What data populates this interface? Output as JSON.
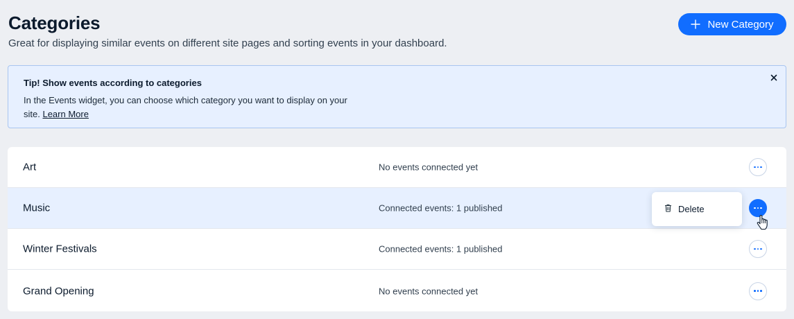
{
  "header": {
    "title": "Categories",
    "subtitle": "Great for displaying similar events on different site pages and sorting events in your dashboard.",
    "new_button_label": "New Category",
    "new_button_icon": "plus-icon"
  },
  "tip": {
    "title": "Tip! Show events according to categories",
    "body": "In the Events widget, you can choose which category you want to display on your site.",
    "link_label": "Learn More",
    "close_icon": "close-icon"
  },
  "categories": [
    {
      "name": "Art",
      "status": "No events connected yet",
      "highlighted": false
    },
    {
      "name": "Music",
      "status": "Connected events: 1 published",
      "highlighted": true
    },
    {
      "name": "Winter Festivals",
      "status": "Connected events: 1 published",
      "highlighted": false
    },
    {
      "name": "Grand Opening",
      "status": "No events connected yet",
      "highlighted": false
    }
  ],
  "menu": {
    "items": [
      {
        "label": "Delete",
        "icon": "trash-icon"
      }
    ]
  },
  "colors": {
    "accent": "#116dff",
    "background": "#edeff3",
    "tip_background": "#e7f0ff",
    "highlight_row": "#e7f0ff"
  }
}
